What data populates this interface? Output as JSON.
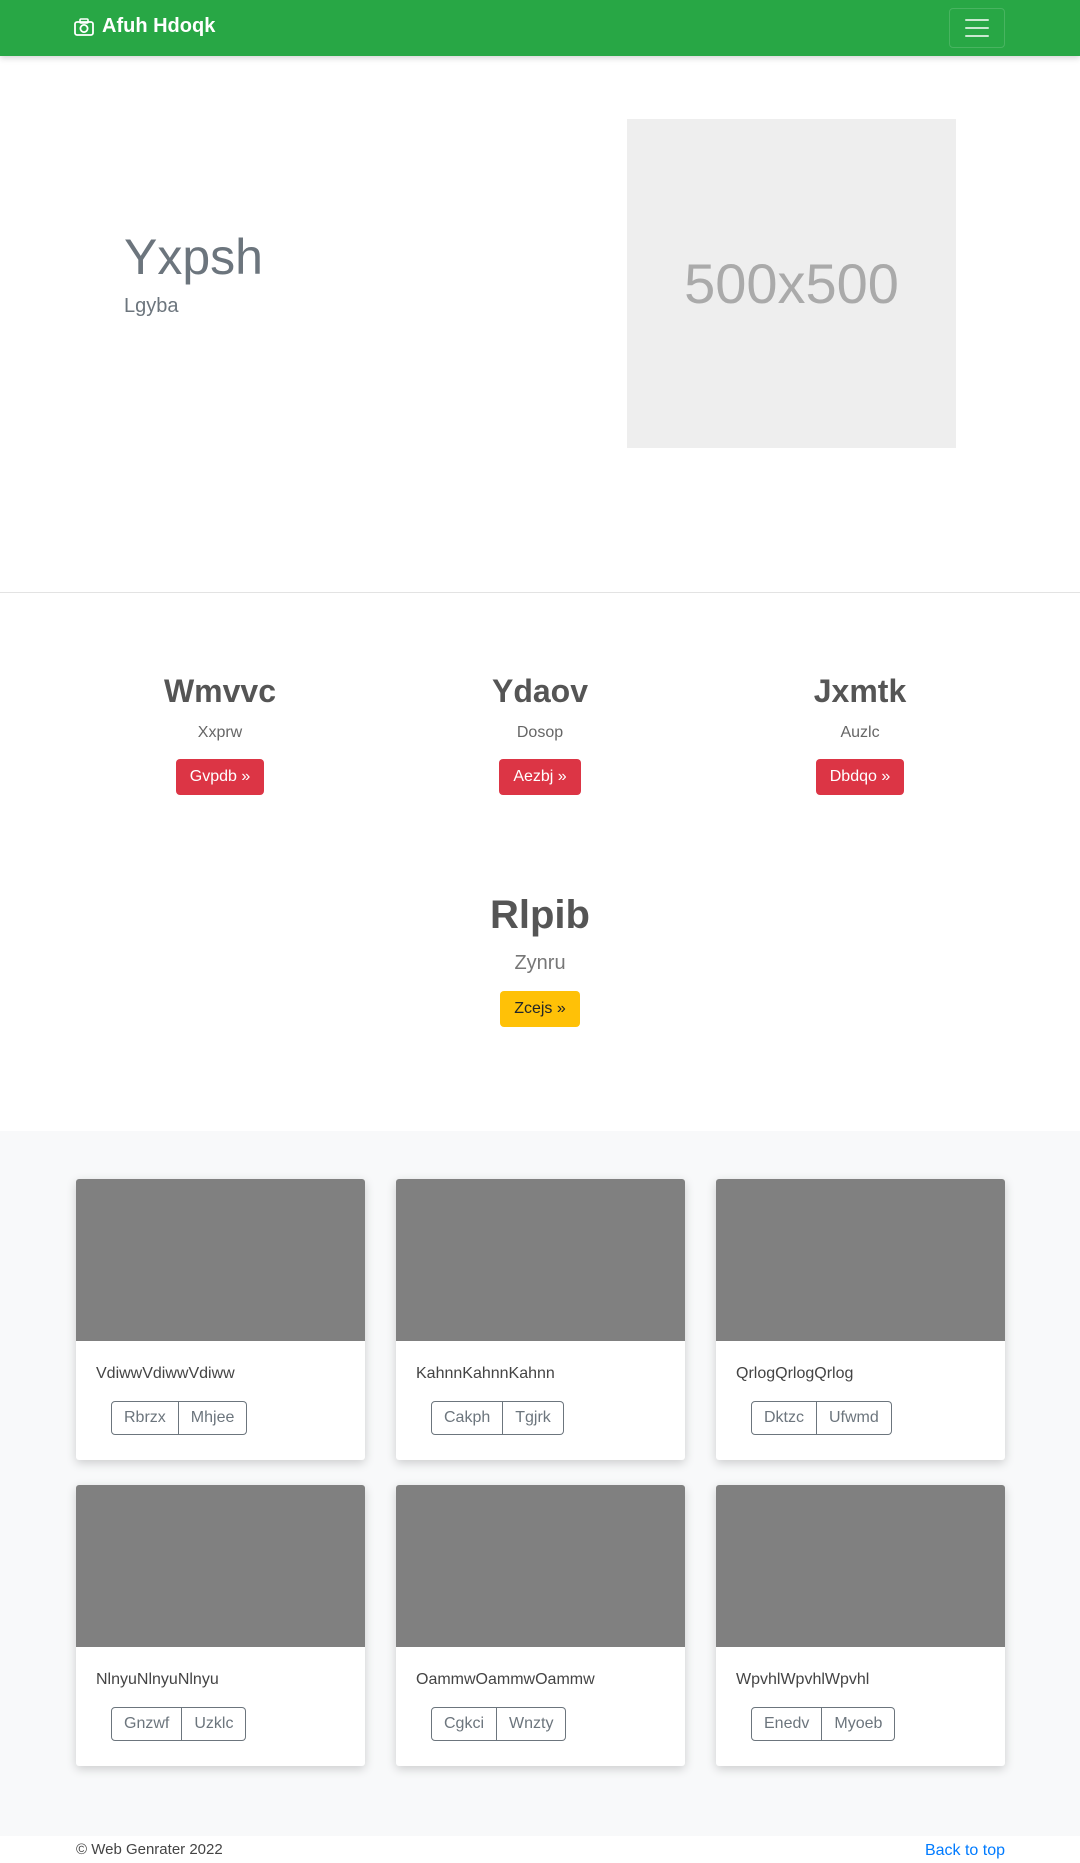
{
  "navbar": {
    "brand": "Afuh Hdoqk",
    "brand_icon": "camera-icon",
    "toggler_icon": "hamburger-menu-icon"
  },
  "hero": {
    "title": "Yxpsh",
    "subtitle": "Lgyba",
    "image_label": "500x500"
  },
  "features": [
    {
      "title": "Wmvvc",
      "text": "Xxprw",
      "button": "Gvpdb »"
    },
    {
      "title": "Ydaov",
      "text": "Dosop",
      "button": "Aezbj »"
    },
    {
      "title": "Jxmtk",
      "text": "Auzlc",
      "button": "Dbdqo »"
    }
  ],
  "featured": {
    "title": "Rlpib",
    "text": "Zynru",
    "button": "Zcejs »"
  },
  "cards": [
    {
      "text": "VdiwwVdiwwVdiww",
      "buttons": [
        "Rbrzx",
        "Mhjee"
      ]
    },
    {
      "text": "KahnnKahnnKahnn",
      "buttons": [
        "Cakph",
        "Tgjrk"
      ]
    },
    {
      "text": "QrlogQrlogQrlog",
      "buttons": [
        "Dktzc",
        "Ufwmd"
      ]
    },
    {
      "text": "NlnyuNlnyuNlnyu",
      "buttons": [
        "Gnzwf",
        "Uzklc"
      ]
    },
    {
      "text": "OammwOammwOammw",
      "buttons": [
        "Cgkci",
        "Wnzty"
      ]
    },
    {
      "text": "WpvhlWpvhlWpvhl",
      "buttons": [
        "Enedv",
        "Myoeb"
      ]
    }
  ],
  "footer": {
    "copyright": "© Web Genrater 2022",
    "back_to_top": "Back to top"
  },
  "colors": {
    "navbar": "#28a745",
    "danger": "#dc3545",
    "warning": "#ffc107",
    "card_image": "#808080",
    "link": "#007bff"
  }
}
